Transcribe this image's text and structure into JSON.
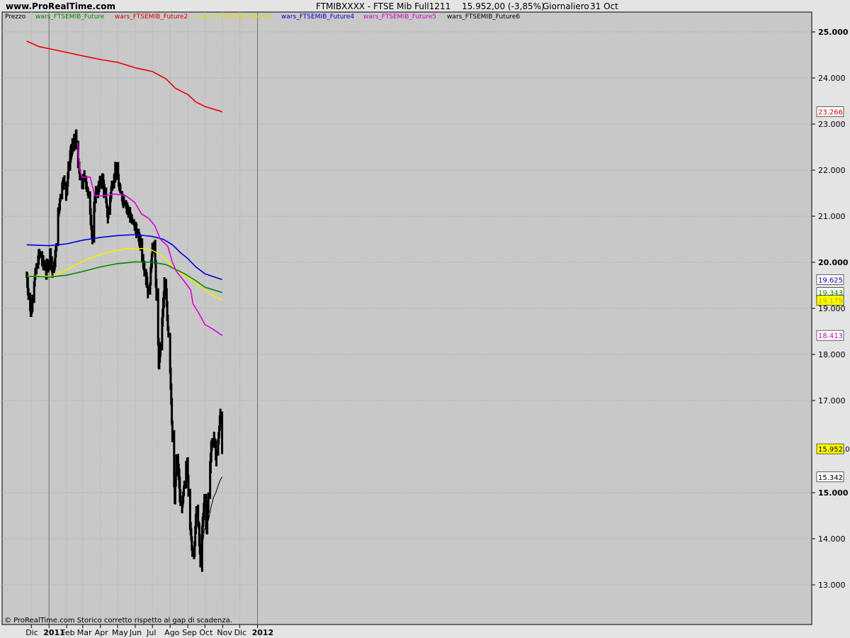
{
  "header": {
    "site": "www.ProRealTime.com",
    "title": "FTMIBXXXX - FTSE Mib Full1211",
    "price_change": "15.952,00 (-3,85%)",
    "timeframe": "Giornaliero",
    "date": "31 Oct"
  },
  "footer": {
    "copyright": "© ProRealTime.com Storico corretto rispetto al gap di scadenza."
  },
  "legend": [
    {
      "text": "Prezzo",
      "color": "#000000"
    },
    {
      "text": "wars_FTSEMIB_Future",
      "color": "#008800"
    },
    {
      "text": "wars_FTSEMIB_Future2",
      "color": "#dd0000"
    },
    {
      "text": "wars_FTSEMIB_Future3",
      "color": "#dddd00"
    },
    {
      "text": "wars_FTSEMIB_Future4",
      "color": "#0000cc"
    },
    {
      "text": "wars_FTSEMIB_Future5",
      "color": "#cc00cc"
    },
    {
      "text": "wars_FTSEMIB_Future6",
      "color": "#000000"
    }
  ],
  "value_labels": [
    {
      "text": "23.266",
      "value": 23266,
      "bg": "#ffffff",
      "color": "#dd0000"
    },
    {
      "text": "19.625",
      "value": 19625,
      "bg": "#ffffff",
      "color": "#0000cc"
    },
    {
      "text": "19.343",
      "value": 19343,
      "bg": "#ffffff",
      "color": "#008800"
    },
    {
      "text": "19.175",
      "value": 19175,
      "bg": "#ffff00",
      "color": "#aaaa00"
    },
    {
      "text": "18.413",
      "value": 18413,
      "bg": "#ffffff",
      "color": "#cc00cc"
    },
    {
      "text": "15.952,0",
      "value": 15952,
      "bg": "#ffff00",
      "color": "#000000"
    },
    {
      "text": "15.342",
      "value": 15342,
      "bg": "#ffffff",
      "color": "#000000"
    }
  ],
  "chart_data": {
    "type": "bar",
    "subtype": "ohlc",
    "ylim": [
      12700,
      25300
    ],
    "grid": true,
    "legend_position": "top-left",
    "y_axis_position": "right",
    "y_ticks": [
      {
        "label": "25.000",
        "value": 25000,
        "bold": true
      },
      {
        "label": "24.000",
        "value": 24000,
        "bold": false
      },
      {
        "label": "23.000",
        "value": 23000,
        "bold": false
      },
      {
        "label": "22.000",
        "value": 22000,
        "bold": false
      },
      {
        "label": "21.000",
        "value": 21000,
        "bold": false
      },
      {
        "label": "20.000",
        "value": 20000,
        "bold": true
      },
      {
        "label": "19.000",
        "value": 19000,
        "bold": false
      },
      {
        "label": "18.000",
        "value": 18000,
        "bold": false
      },
      {
        "label": "17.000",
        "value": 17000,
        "bold": false
      },
      {
        "label": "15.000",
        "value": 15000,
        "bold": true
      },
      {
        "label": "14.000",
        "value": 14000,
        "bold": false
      },
      {
        "label": "13.000",
        "value": 13000,
        "bold": false
      }
    ],
    "x_ticks": [
      {
        "label": "Dic",
        "date": "2010-12-01",
        "bold": false
      },
      {
        "label": "2011",
        "date": "2011-01-01",
        "bold": true
      },
      {
        "label": "Feb",
        "date": "2011-02-01",
        "bold": false
      },
      {
        "label": "Mar",
        "date": "2011-03-01",
        "bold": false
      },
      {
        "label": "Apr",
        "date": "2011-04-01",
        "bold": false
      },
      {
        "label": "May",
        "date": "2011-05-01",
        "bold": false
      },
      {
        "label": "Jun",
        "date": "2011-06-01",
        "bold": false
      },
      {
        "label": "Jul",
        "date": "2011-07-01",
        "bold": false
      },
      {
        "label": "Ago",
        "date": "2011-08-01",
        "bold": false
      },
      {
        "label": "Sep",
        "date": "2011-09-01",
        "bold": false
      },
      {
        "label": "Oct",
        "date": "2011-10-01",
        "bold": false
      },
      {
        "label": "Nov",
        "date": "2011-11-01",
        "bold": false
      },
      {
        "label": "Dic",
        "date": "2011-12-01",
        "bold": false
      },
      {
        "label": "2012",
        "date": "2012-01-01",
        "bold": true
      }
    ],
    "price_anchors": [
      [
        "2010-11-23",
        19700
      ],
      [
        "2010-11-27",
        19200
      ],
      [
        "2010-11-30",
        18900
      ],
      [
        "2010-12-04",
        19400
      ],
      [
        "2010-12-09",
        19800
      ],
      [
        "2010-12-15",
        20200
      ],
      [
        "2010-12-21",
        20000
      ],
      [
        "2010-12-27",
        19800
      ],
      [
        "2011-01-03",
        20200
      ],
      [
        "2011-01-08",
        19700
      ],
      [
        "2011-01-12",
        20100
      ],
      [
        "2011-01-17",
        21000
      ],
      [
        "2011-01-21",
        21500
      ],
      [
        "2011-01-26",
        21800
      ],
      [
        "2011-01-31",
        21500
      ],
      [
        "2011-02-06",
        22300
      ],
      [
        "2011-02-11",
        22500
      ],
      [
        "2011-02-17",
        22700
      ],
      [
        "2011-02-21",
        22200
      ],
      [
        "2011-02-24",
        21800
      ],
      [
        "2011-03-01",
        21700
      ],
      [
        "2011-03-05",
        21900
      ],
      [
        "2011-03-10",
        21500
      ],
      [
        "2011-03-15",
        21000
      ],
      [
        "2011-03-18",
        20500
      ],
      [
        "2011-03-23",
        21500
      ],
      [
        "2011-03-29",
        21600
      ],
      [
        "2011-04-04",
        21900
      ],
      [
        "2011-04-08",
        21500
      ],
      [
        "2011-04-14",
        21000
      ],
      [
        "2011-04-20",
        21600
      ],
      [
        "2011-04-27",
        22000
      ],
      [
        "2011-05-01",
        21900
      ],
      [
        "2011-05-05",
        21500
      ],
      [
        "2011-05-10",
        21400
      ],
      [
        "2011-05-15",
        21300
      ],
      [
        "2011-05-20",
        21100
      ],
      [
        "2011-05-25",
        20900
      ],
      [
        "2011-05-31",
        20800
      ],
      [
        "2011-06-05",
        20600
      ],
      [
        "2011-06-10",
        20400
      ],
      [
        "2011-06-15",
        20000
      ],
      [
        "2011-06-20",
        19700
      ],
      [
        "2011-06-24",
        19300
      ],
      [
        "2011-06-27",
        19600
      ],
      [
        "2011-07-01",
        20400
      ],
      [
        "2011-07-05",
        20300
      ],
      [
        "2011-07-09",
        18900
      ],
      [
        "2011-07-12",
        17800
      ],
      [
        "2011-07-16",
        18300
      ],
      [
        "2011-07-19",
        18900
      ],
      [
        "2011-07-23",
        19700
      ],
      [
        "2011-07-27",
        18800
      ],
      [
        "2011-07-31",
        18100
      ],
      [
        "2011-08-03",
        17000
      ],
      [
        "2011-08-06",
        15800
      ],
      [
        "2011-08-09",
        14800
      ],
      [
        "2011-08-12",
        15700
      ],
      [
        "2011-08-16",
        15400
      ],
      [
        "2011-08-19",
        14700
      ],
      [
        "2011-08-23",
        14800
      ],
      [
        "2011-08-27",
        15300
      ],
      [
        "2011-08-31",
        15700
      ],
      [
        "2011-09-03",
        14800
      ],
      [
        "2011-09-06",
        14100
      ],
      [
        "2011-09-10",
        13600
      ],
      [
        "2011-09-13",
        13900
      ],
      [
        "2011-09-16",
        14700
      ],
      [
        "2011-09-20",
        14200
      ],
      [
        "2011-09-23",
        13500
      ],
      [
        "2011-09-26",
        14100
      ],
      [
        "2011-09-30",
        14900
      ],
      [
        "2011-10-04",
        14200
      ],
      [
        "2011-10-08",
        15200
      ],
      [
        "2011-10-12",
        16000
      ],
      [
        "2011-10-16",
        16300
      ],
      [
        "2011-10-20",
        15800
      ],
      [
        "2011-10-24",
        16100
      ],
      [
        "2011-10-28",
        16700
      ],
      [
        "2011-10-31",
        15952
      ]
    ],
    "series": [
      {
        "name": "wars_FTSEMIB_Future2",
        "color": "#ee0000",
        "width": 1.6,
        "points": [
          [
            "2010-11-23",
            24800
          ],
          [
            "2010-12-15",
            24680
          ],
          [
            "2011-01-15",
            24600
          ],
          [
            "2011-03-01",
            24480
          ],
          [
            "2011-04-01",
            24400
          ],
          [
            "2011-05-01",
            24340
          ],
          [
            "2011-06-01",
            24220
          ],
          [
            "2011-07-01",
            24140
          ],
          [
            "2011-07-25",
            23980
          ],
          [
            "2011-08-10",
            23780
          ],
          [
            "2011-09-01",
            23640
          ],
          [
            "2011-09-15",
            23480
          ],
          [
            "2011-10-01",
            23380
          ],
          [
            "2011-10-31",
            23266
          ]
        ]
      },
      {
        "name": "wars_FTSEMIB_Future4",
        "color": "#0000dd",
        "width": 1.6,
        "points": [
          [
            "2010-11-23",
            20380
          ],
          [
            "2011-01-01",
            20360
          ],
          [
            "2011-02-01",
            20400
          ],
          [
            "2011-03-01",
            20480
          ],
          [
            "2011-04-01",
            20540
          ],
          [
            "2011-05-01",
            20580
          ],
          [
            "2011-06-01",
            20600
          ],
          [
            "2011-07-01",
            20560
          ],
          [
            "2011-07-20",
            20500
          ],
          [
            "2011-08-05",
            20380
          ],
          [
            "2011-08-20",
            20200
          ],
          [
            "2011-09-01",
            20080
          ],
          [
            "2011-09-15",
            19900
          ],
          [
            "2011-10-01",
            19750
          ],
          [
            "2011-10-31",
            19625
          ]
        ]
      },
      {
        "name": "wars_FTSEMIB_Future3",
        "color": "#eeee00",
        "width": 1.6,
        "points": [
          [
            "2010-11-23",
            19700
          ],
          [
            "2011-01-10",
            19700
          ],
          [
            "2011-02-01",
            19840
          ],
          [
            "2011-02-20",
            19960
          ],
          [
            "2011-03-15",
            20100
          ],
          [
            "2011-04-15",
            20220
          ],
          [
            "2011-05-15",
            20290
          ],
          [
            "2011-06-15",
            20300
          ],
          [
            "2011-07-01",
            20260
          ],
          [
            "2011-07-20",
            20120
          ],
          [
            "2011-08-05",
            19920
          ],
          [
            "2011-08-20",
            19760
          ],
          [
            "2011-09-10",
            19600
          ],
          [
            "2011-10-01",
            19380
          ],
          [
            "2011-10-31",
            19175
          ]
        ]
      },
      {
        "name": "wars_FTSEMIB_Future",
        "color": "#008800",
        "width": 1.6,
        "points": [
          [
            "2010-11-23",
            19700
          ],
          [
            "2011-01-01",
            19680
          ],
          [
            "2011-02-01",
            19720
          ],
          [
            "2011-03-01",
            19800
          ],
          [
            "2011-04-01",
            19900
          ],
          [
            "2011-05-01",
            19970
          ],
          [
            "2011-06-01",
            20010
          ],
          [
            "2011-07-01",
            20000
          ],
          [
            "2011-07-25",
            19950
          ],
          [
            "2011-08-10",
            19850
          ],
          [
            "2011-08-25",
            19760
          ],
          [
            "2011-09-15",
            19600
          ],
          [
            "2011-10-01",
            19460
          ],
          [
            "2011-10-31",
            19343
          ]
        ]
      },
      {
        "name": "wars_FTSEMIB_Future5",
        "color": "#dd00dd",
        "width": 1.6,
        "points": [
          [
            "2011-02-20",
            22600
          ],
          [
            "2011-02-24",
            22000
          ],
          [
            "2011-02-28",
            21850
          ],
          [
            "2011-03-14",
            21850
          ],
          [
            "2011-03-17",
            21700
          ],
          [
            "2011-03-22",
            21450
          ],
          [
            "2011-04-05",
            21440
          ],
          [
            "2011-04-25",
            21480
          ],
          [
            "2011-05-15",
            21450
          ],
          [
            "2011-05-31",
            21300
          ],
          [
            "2011-06-12",
            21050
          ],
          [
            "2011-06-25",
            20950
          ],
          [
            "2011-07-05",
            20800
          ],
          [
            "2011-07-15",
            20500
          ],
          [
            "2011-07-28",
            20350
          ],
          [
            "2011-08-05",
            20000
          ],
          [
            "2011-08-12",
            19800
          ],
          [
            "2011-08-25",
            19600
          ],
          [
            "2011-09-06",
            19400
          ],
          [
            "2011-09-10",
            19100
          ],
          [
            "2011-09-20",
            18900
          ],
          [
            "2011-10-01",
            18650
          ],
          [
            "2011-10-15",
            18550
          ],
          [
            "2011-10-31",
            18413
          ]
        ]
      },
      {
        "name": "wars_FTSEMIB_Future6",
        "color": "#000000",
        "width": 1.0,
        "points": [
          [
            "2011-09-23",
            13400
          ],
          [
            "2011-09-27",
            13900
          ],
          [
            "2011-09-30",
            14200
          ],
          [
            "2011-10-04",
            14300
          ],
          [
            "2011-10-08",
            14450
          ],
          [
            "2011-10-12",
            14700
          ],
          [
            "2011-10-16",
            14900
          ],
          [
            "2011-10-20",
            15000
          ],
          [
            "2011-10-24",
            15150
          ],
          [
            "2011-10-28",
            15280
          ],
          [
            "2011-10-31",
            15342
          ]
        ]
      }
    ]
  }
}
